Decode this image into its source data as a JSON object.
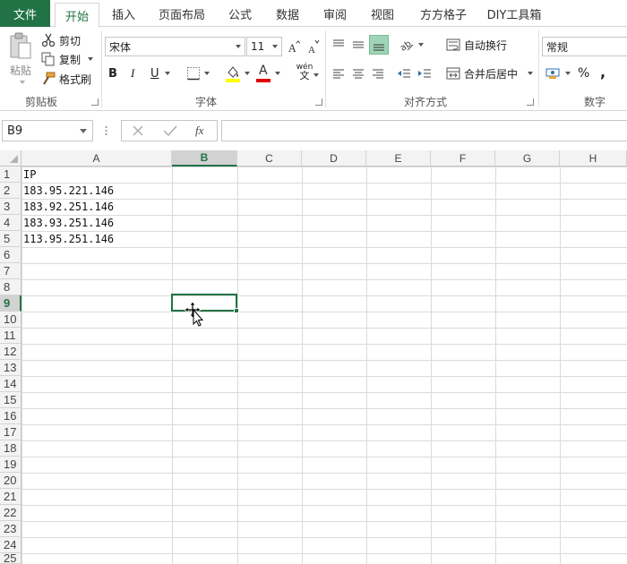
{
  "tabs": {
    "file": "文件",
    "items": [
      {
        "label": "开始",
        "active": true
      },
      {
        "label": "插入",
        "active": false
      },
      {
        "label": "页面布局",
        "active": false
      },
      {
        "label": "公式",
        "active": false
      },
      {
        "label": "数据",
        "active": false
      },
      {
        "label": "审阅",
        "active": false
      },
      {
        "label": "视图",
        "active": false
      },
      {
        "label": "方方格子",
        "active": false
      },
      {
        "label": "DIY工具箱",
        "active": false
      }
    ]
  },
  "ribbon": {
    "clipboard": {
      "paste": "粘贴",
      "cut": "剪切",
      "copy": "复制",
      "format_painter": "格式刷",
      "group": "剪贴板"
    },
    "font": {
      "name": "宋体",
      "size": "11",
      "bold": "B",
      "italic": "I",
      "underline": "U",
      "font_color_letter": "A",
      "phonetic": "wén",
      "phonetic_sub": "文",
      "group": "字体"
    },
    "alignment": {
      "wrap": "自动换行",
      "merge": "合并后居中",
      "group": "对齐方式"
    },
    "number": {
      "format": "常规",
      "percent": "%",
      "comma": ",",
      "group": "数字"
    }
  },
  "formula_bar": {
    "name_box": "B9",
    "fx": "fx",
    "value": ""
  },
  "sheet": {
    "columns": [
      "A",
      "B",
      "C",
      "D",
      "E",
      "F",
      "G",
      "H"
    ],
    "selected_column": "B",
    "rows": [
      "1",
      "2",
      "3",
      "4",
      "5",
      "6",
      "7",
      "8",
      "9",
      "10",
      "11",
      "12",
      "13",
      "14",
      "15",
      "16",
      "17",
      "18",
      "19",
      "20",
      "21",
      "22",
      "23",
      "24",
      "25"
    ],
    "selected_row": "9",
    "cells": [
      {
        "ref": "A1",
        "value": "IP"
      },
      {
        "ref": "A2",
        "value": "183.95.221.146"
      },
      {
        "ref": "A3",
        "value": "183.92.251.146"
      },
      {
        "ref": "A4",
        "value": "183.93.251.146"
      },
      {
        "ref": "A5",
        "value": "113.95.251.146"
      }
    ]
  },
  "colors": {
    "accent": "#217346",
    "header_bg": "#f3f3f3",
    "gridline": "#dadada"
  }
}
